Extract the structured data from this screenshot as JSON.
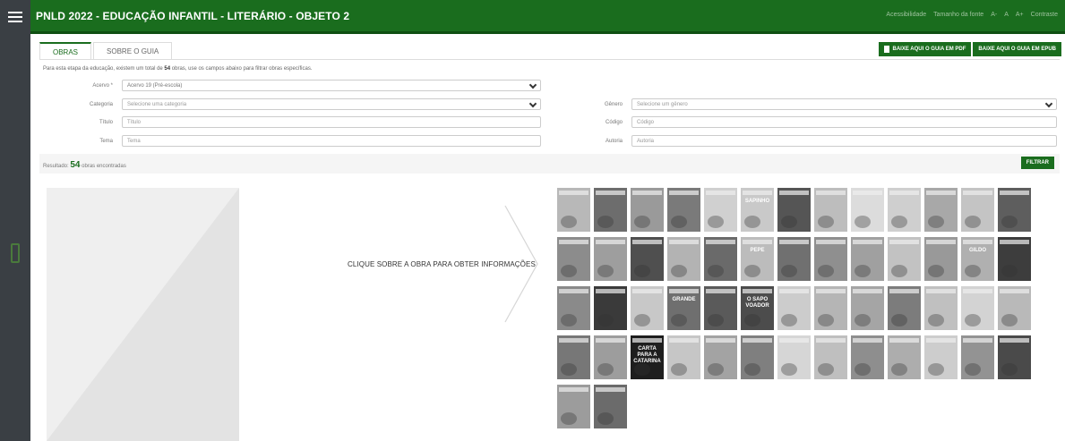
{
  "header": {
    "title": "PNLD 2022 - EDUCAÇÃO INFANTIL - LITERÁRIO - OBJETO 2",
    "tools": [
      "Acessibilidade",
      "Tamanho da fonte",
      "A-",
      "A",
      "A+",
      "Contraste"
    ]
  },
  "tabs": [
    {
      "label": "OBRAS",
      "active": true
    },
    {
      "label": "SOBRE O GUIA",
      "active": false
    }
  ],
  "downloads": {
    "pdf": "BAIXE AQUI O GUIA EM PDF",
    "epub": "BAIXE AQUI O GUIA EM EPUB"
  },
  "intro": {
    "before": "Para esta etapa da educação, existem um total de ",
    "count": "54",
    "after": " obras, use os campos abaixo para filtrar obras específicas."
  },
  "filters": {
    "acervo": {
      "label": "Acervo *",
      "value": "Acervo 19 (Pré-escola)"
    },
    "categoria": {
      "label": "Categoria",
      "placeholder": "Selecione uma categoria"
    },
    "genero": {
      "label": "Gênero",
      "placeholder": "Selecione um gênero"
    },
    "titulo": {
      "label": "Título",
      "placeholder": "Título"
    },
    "codigo": {
      "label": "Código",
      "placeholder": "Código"
    },
    "tema": {
      "label": "Tema",
      "placeholder": "Tema"
    },
    "autoria": {
      "label": "Autoria",
      "placeholder": "Autoria"
    }
  },
  "result": {
    "prefix": "Resultado: ",
    "count": "54",
    "suffix": " obras encontradas",
    "filter_label": "FILTRAR"
  },
  "prompt": "CLIQUE SOBRE A OBRA PARA OBTER INFORMAÇÕES",
  "covers": [
    {
      "shade": "#b8b8b8",
      "text": ""
    },
    {
      "shade": "#6d6d6d",
      "text": ""
    },
    {
      "shade": "#9a9a9a",
      "text": ""
    },
    {
      "shade": "#7a7a7a",
      "text": ""
    },
    {
      "shade": "#d0d0d0",
      "text": ""
    },
    {
      "shade": "#c9c9c9",
      "text": "SAPINHO"
    },
    {
      "shade": "#555555",
      "text": ""
    },
    {
      "shade": "#bdbdbd",
      "text": ""
    },
    {
      "shade": "#dcdcdc",
      "text": ""
    },
    {
      "shade": "#cfcfcf",
      "text": ""
    },
    {
      "shade": "#a8a8a8",
      "text": ""
    },
    {
      "shade": "#c4c4c4",
      "text": ""
    },
    {
      "shade": "#5e5e5e",
      "text": ""
    },
    {
      "shade": "#8c8c8c",
      "text": ""
    },
    {
      "shade": "#9e9e9e",
      "text": ""
    },
    {
      "shade": "#4f4f4f",
      "text": ""
    },
    {
      "shade": "#b3b3b3",
      "text": ""
    },
    {
      "shade": "#6a6a6a",
      "text": ""
    },
    {
      "shade": "#bcbcbc",
      "text": "PEPE"
    },
    {
      "shade": "#707070",
      "text": ""
    },
    {
      "shade": "#8f8f8f",
      "text": ""
    },
    {
      "shade": "#a0a0a0",
      "text": ""
    },
    {
      "shade": "#c2c2c2",
      "text": ""
    },
    {
      "shade": "#999999",
      "text": ""
    },
    {
      "shade": "#b0b0b0",
      "text": "GILDO"
    },
    {
      "shade": "#3d3d3d",
      "text": ""
    },
    {
      "shade": "#8a8a8a",
      "text": ""
    },
    {
      "shade": "#3a3a3a",
      "text": ""
    },
    {
      "shade": "#c8c8c8",
      "text": ""
    },
    {
      "shade": "#6f6f6f",
      "text": "GRANDE"
    },
    {
      "shade": "#5a5a5a",
      "text": ""
    },
    {
      "shade": "#4c4c4c",
      "text": "O SAPO VOADOR"
    },
    {
      "shade": "#cccccc",
      "text": ""
    },
    {
      "shade": "#b5b5b5",
      "text": ""
    },
    {
      "shade": "#a5a5a5",
      "text": ""
    },
    {
      "shade": "#7c7c7c",
      "text": ""
    },
    {
      "shade": "#c0c0c0",
      "text": ""
    },
    {
      "shade": "#d3d3d3",
      "text": ""
    },
    {
      "shade": "#b9b9b9",
      "text": ""
    },
    {
      "shade": "#777777",
      "text": ""
    },
    {
      "shade": "#9d9d9d",
      "text": ""
    },
    {
      "shade": "#1e1e1e",
      "text": "CARTA PARA A CATARINA"
    },
    {
      "shade": "#c6c6c6",
      "text": ""
    },
    {
      "shade": "#a3a3a3",
      "text": ""
    },
    {
      "shade": "#7f7f7f",
      "text": ""
    },
    {
      "shade": "#d6d6d6",
      "text": ""
    },
    {
      "shade": "#bfbfbf",
      "text": ""
    },
    {
      "shade": "#8e8e8e",
      "text": ""
    },
    {
      "shade": "#adadad",
      "text": ""
    },
    {
      "shade": "#cdcdcd",
      "text": ""
    },
    {
      "shade": "#939393",
      "text": ""
    },
    {
      "shade": "#4a4a4a",
      "text": ""
    },
    {
      "shade": "#9c9c9c",
      "text": ""
    },
    {
      "shade": "#6b6b6b",
      "text": ""
    }
  ],
  "colors": {
    "brand": "#1a6d1e",
    "sidebar": "#3a3f44"
  }
}
